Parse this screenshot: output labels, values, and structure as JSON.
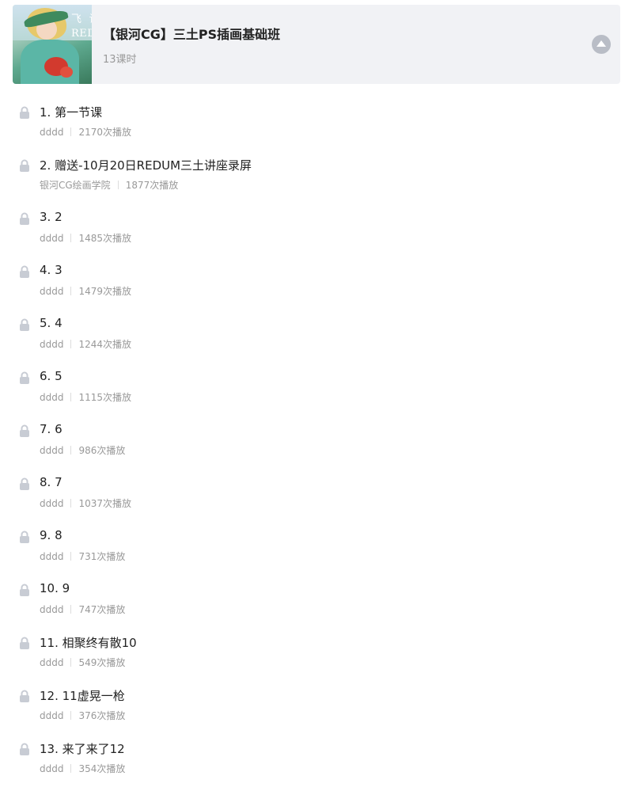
{
  "course": {
    "cover_text": "飞  读\nRED",
    "title": "【银河CG】三土PS插画基础班",
    "lesson_count": "13课时"
  },
  "lessons": [
    {
      "title": "1. 第一节课",
      "author": "dddd",
      "plays": "2170次播放"
    },
    {
      "title": "2. 赠送-10月20日REDUM三土讲座录屏",
      "author": "银河CG绘画学院",
      "plays": "1877次播放"
    },
    {
      "title": "3. 2",
      "author": "dddd",
      "plays": "1485次播放"
    },
    {
      "title": "4. 3",
      "author": "dddd",
      "plays": "1479次播放"
    },
    {
      "title": "5. 4",
      "author": "dddd",
      "plays": "1244次播放"
    },
    {
      "title": "6. 5",
      "author": "dddd",
      "plays": "1115次播放"
    },
    {
      "title": "7. 6",
      "author": "dddd",
      "plays": "986次播放"
    },
    {
      "title": "8. 7",
      "author": "dddd",
      "plays": "1037次播放"
    },
    {
      "title": "9. 8",
      "author": "dddd",
      "plays": "731次播放"
    },
    {
      "title": "10. 9",
      "author": "dddd",
      "plays": "747次播放"
    },
    {
      "title": "11. 相聚终有散10",
      "author": "dddd",
      "plays": "549次播放"
    },
    {
      "title": "12. 11虚晃一枪",
      "author": "dddd",
      "plays": "376次播放"
    },
    {
      "title": "13. 来了来了12",
      "author": "dddd",
      "plays": "354次播放"
    }
  ]
}
